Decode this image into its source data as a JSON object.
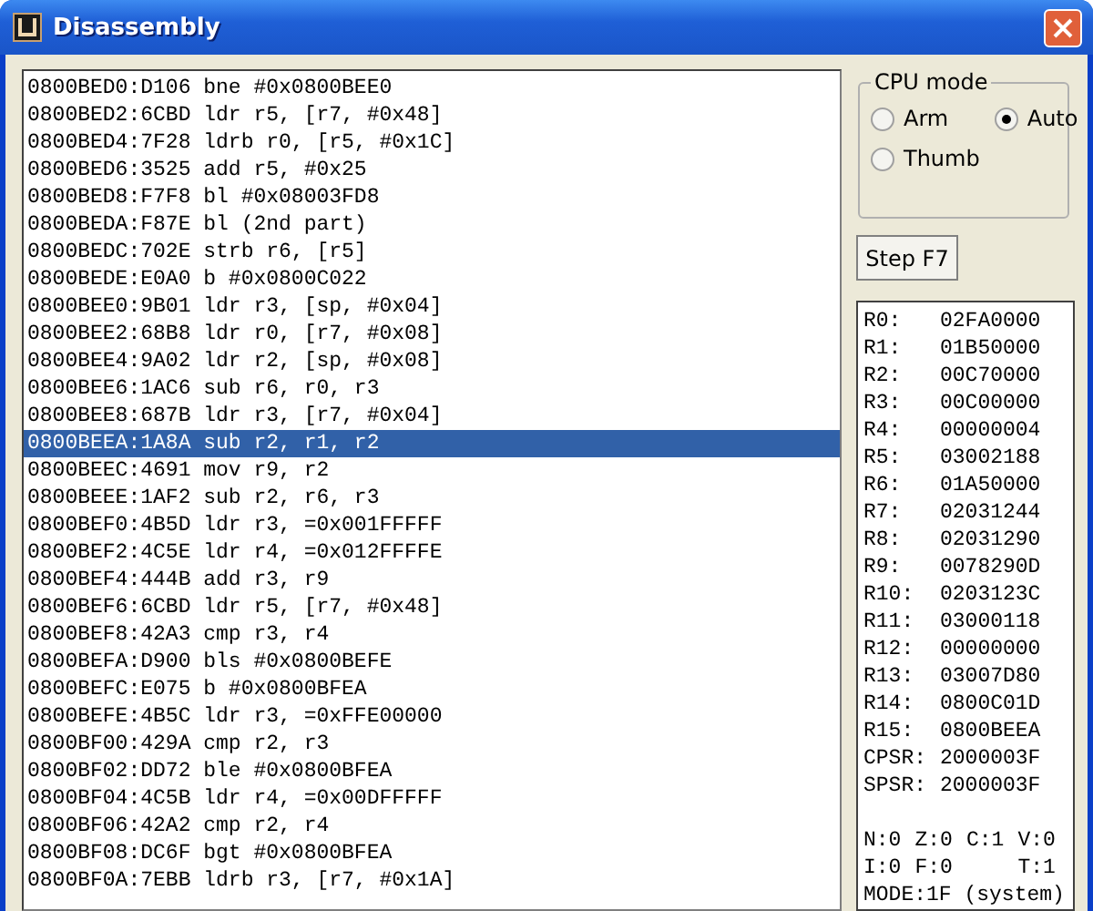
{
  "window": {
    "title": "Disassembly"
  },
  "disassembly": [
    {
      "text": "0800BED0:D106 bne #0x0800BEE0",
      "selected": false
    },
    {
      "text": "0800BED2:6CBD ldr r5, [r7, #0x48]",
      "selected": false
    },
    {
      "text": "0800BED4:7F28 ldrb r0, [r5, #0x1C]",
      "selected": false
    },
    {
      "text": "0800BED6:3525 add r5, #0x25",
      "selected": false
    },
    {
      "text": "0800BED8:F7F8 bl #0x08003FD8",
      "selected": false
    },
    {
      "text": "0800BEDA:F87E bl (2nd part)",
      "selected": false
    },
    {
      "text": "0800BEDC:702E strb r6, [r5]",
      "selected": false
    },
    {
      "text": "0800BEDE:E0A0 b #0x0800C022",
      "selected": false
    },
    {
      "text": "0800BEE0:9B01 ldr r3, [sp, #0x04]",
      "selected": false
    },
    {
      "text": "0800BEE2:68B8 ldr r0, [r7, #0x08]",
      "selected": false
    },
    {
      "text": "0800BEE4:9A02 ldr r2, [sp, #0x08]",
      "selected": false
    },
    {
      "text": "0800BEE6:1AC6 sub r6, r0, r3",
      "selected": false
    },
    {
      "text": "0800BEE8:687B ldr r3, [r7, #0x04]",
      "selected": false
    },
    {
      "text": "0800BEEA:1A8A sub r2, r1, r2",
      "selected": true
    },
    {
      "text": "0800BEEC:4691 mov r9, r2",
      "selected": false
    },
    {
      "text": "0800BEEE:1AF2 sub r2, r6, r3",
      "selected": false
    },
    {
      "text": "0800BEF0:4B5D ldr r3, =0x001FFFFF",
      "selected": false
    },
    {
      "text": "0800BEF2:4C5E ldr r4, =0x012FFFFE",
      "selected": false
    },
    {
      "text": "0800BEF4:444B add r3, r9",
      "selected": false
    },
    {
      "text": "0800BEF6:6CBD ldr r5, [r7, #0x48]",
      "selected": false
    },
    {
      "text": "0800BEF8:42A3 cmp r3, r4",
      "selected": false
    },
    {
      "text": "0800BEFA:D900 bls #0x0800BEFE",
      "selected": false
    },
    {
      "text": "0800BEFC:E075 b #0x0800BFEA",
      "selected": false
    },
    {
      "text": "0800BEFE:4B5C ldr r3, =0xFFE00000",
      "selected": false
    },
    {
      "text": "0800BF00:429A cmp r2, r3",
      "selected": false
    },
    {
      "text": "0800BF02:DD72 ble #0x0800BFEA",
      "selected": false
    },
    {
      "text": "0800BF04:4C5B ldr r4, =0x00DFFFFF",
      "selected": false
    },
    {
      "text": "0800BF06:42A2 cmp r2, r4",
      "selected": false
    },
    {
      "text": "0800BF08:DC6F bgt #0x0800BFEA",
      "selected": false
    },
    {
      "text": "0800BF0A:7EBB ldrb r3, [r7, #0x1A]",
      "selected": false
    }
  ],
  "cpu_mode": {
    "title": "CPU mode",
    "options": [
      {
        "label": "Arm",
        "selected": false
      },
      {
        "label": "Auto",
        "selected": true
      },
      {
        "label": "Thumb",
        "selected": false
      }
    ]
  },
  "step_button": "Step F7",
  "registers": [
    {
      "name": "R0:",
      "value": "02FA0000"
    },
    {
      "name": "R1:",
      "value": "01B50000"
    },
    {
      "name": "R2:",
      "value": "00C70000"
    },
    {
      "name": "R3:",
      "value": "00C00000"
    },
    {
      "name": "R4:",
      "value": "00000004"
    },
    {
      "name": "R5:",
      "value": "03002188"
    },
    {
      "name": "R6:",
      "value": "01A50000"
    },
    {
      "name": "R7:",
      "value": "02031244"
    },
    {
      "name": "R8:",
      "value": "02031290"
    },
    {
      "name": "R9:",
      "value": "0078290D"
    },
    {
      "name": "R10:",
      "value": "0203123C"
    },
    {
      "name": "R11:",
      "value": "03000118"
    },
    {
      "name": "R12:",
      "value": "00000000"
    },
    {
      "name": "R13:",
      "value": "03007D80"
    },
    {
      "name": "R14:",
      "value": "0800C01D"
    },
    {
      "name": "R15:",
      "value": "0800BEEA"
    },
    {
      "name": "CPSR:",
      "value": "2000003F"
    },
    {
      "name": "SPSR:",
      "value": "2000003F"
    }
  ],
  "flags": [
    [
      "N:0",
      "Z:0",
      "C:1",
      "V:0"
    ],
    [
      "I:0",
      "F:0",
      "T:1"
    ]
  ],
  "mode": "MODE:1F (system)"
}
